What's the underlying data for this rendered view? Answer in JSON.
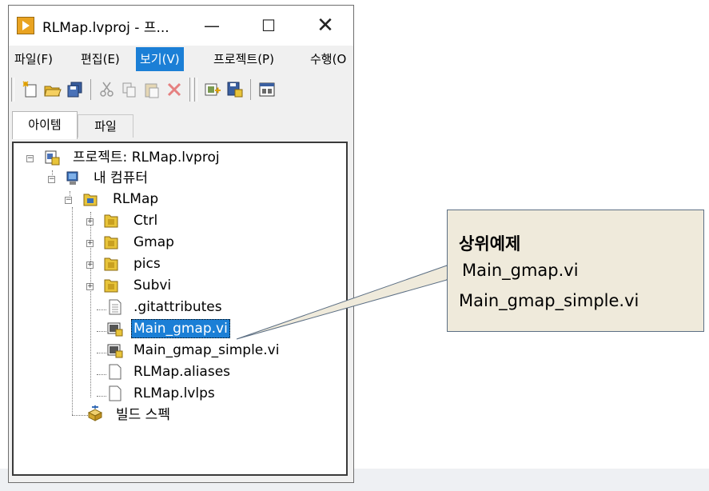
{
  "window": {
    "title": "RLMap.lvproj - 프...",
    "minimize_glyph": "—",
    "maximize_glyph": "☐",
    "close_glyph": "✕"
  },
  "menu": [
    {
      "label": "파일(F)"
    },
    {
      "label": "편집(E)"
    },
    {
      "label": "보기(V)",
      "active": true
    },
    {
      "label": "프로젝트(P)"
    },
    {
      "label": "수행(O"
    }
  ],
  "tabs": [
    {
      "label": "아이템",
      "selected": true
    },
    {
      "label": "파일",
      "selected": false
    }
  ],
  "tree": {
    "root": "프로젝트: RLMap.lvproj",
    "computer": "내 컴퓨터",
    "folder": "RLMap",
    "children": [
      {
        "label": "Ctrl",
        "icon": "folder-icon"
      },
      {
        "label": "Gmap",
        "icon": "folder-icon"
      },
      {
        "label": "pics",
        "icon": "folder-icon"
      },
      {
        "label": "Subvi",
        "icon": "folder-icon"
      },
      {
        "label": ".gitattributes",
        "icon": "file-icon"
      },
      {
        "label": "Main_gmap.vi",
        "icon": "vi-icon",
        "selected": true
      },
      {
        "label": "Main_gmap_simple.vi",
        "icon": "vi-icon"
      },
      {
        "label": "RLMap.aliases",
        "icon": "file-icon"
      },
      {
        "label": "RLMap.lvlps",
        "icon": "file-icon"
      }
    ],
    "build": "빌드 스펙"
  },
  "callout": {
    "title": "상위예제",
    "line1": "Main_gmap.vi",
    "line2": "Main_gmap_simple.vi"
  },
  "colors": {
    "accent": "#1b7fd6",
    "callout_fill": "#efeadb",
    "callout_border": "#5c6f84",
    "folder": "#e8c43a"
  }
}
